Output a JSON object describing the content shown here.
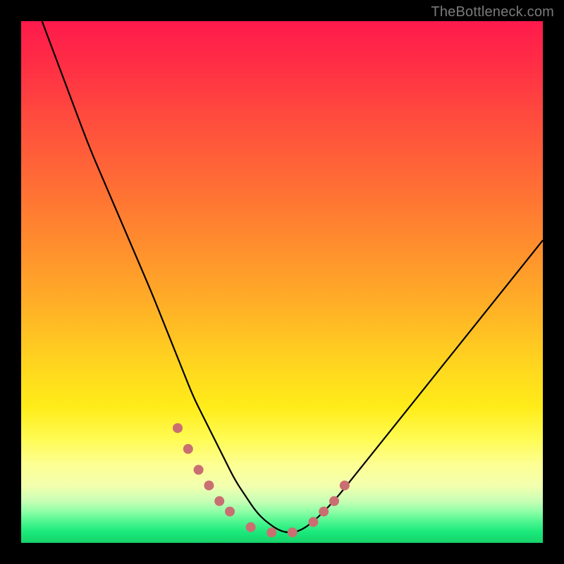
{
  "watermark": {
    "text": "TheBottleneck.com"
  },
  "chart_data": {
    "type": "line",
    "title": "",
    "xlabel": "",
    "ylabel": "",
    "xlim": [
      0,
      100
    ],
    "ylim": [
      0,
      100
    ],
    "grid": false,
    "series": [
      {
        "name": "bottleneck-curve",
        "color": "#000000",
        "x": [
          4,
          7,
          10,
          13,
          16,
          19,
          22,
          25,
          27,
          29,
          31,
          33,
          35,
          37,
          39,
          41,
          43,
          45,
          47,
          50,
          53,
          56,
          60,
          64,
          68,
          72,
          76,
          80,
          84,
          88,
          92,
          96,
          100
        ],
        "y": [
          100,
          92,
          84,
          76,
          69,
          62,
          55,
          48,
          43,
          38,
          33,
          28,
          24,
          20,
          16,
          12,
          9,
          6,
          4,
          2,
          2,
          4,
          8,
          13,
          18,
          23,
          28,
          33,
          38,
          43,
          48,
          53,
          58
        ]
      },
      {
        "name": "highlight-markers",
        "color": "#c96f72",
        "type": "scatter",
        "x": [
          30,
          32,
          34,
          36,
          38,
          40,
          44,
          48,
          52,
          56,
          58,
          60,
          62
        ],
        "y": [
          22,
          18,
          14,
          11,
          8,
          6,
          3,
          2,
          2,
          4,
          6,
          8,
          11
        ]
      }
    ],
    "background_gradient": {
      "orientation": "vertical",
      "stops": [
        {
          "pos": 0,
          "color": "#ff1a4c"
        },
        {
          "pos": 30,
          "color": "#ff6a36"
        },
        {
          "pos": 66,
          "color": "#ffd61f"
        },
        {
          "pos": 85,
          "color": "#fdff93"
        },
        {
          "pos": 96,
          "color": "#4cf58f"
        },
        {
          "pos": 100,
          "color": "#17d36b"
        }
      ]
    }
  }
}
